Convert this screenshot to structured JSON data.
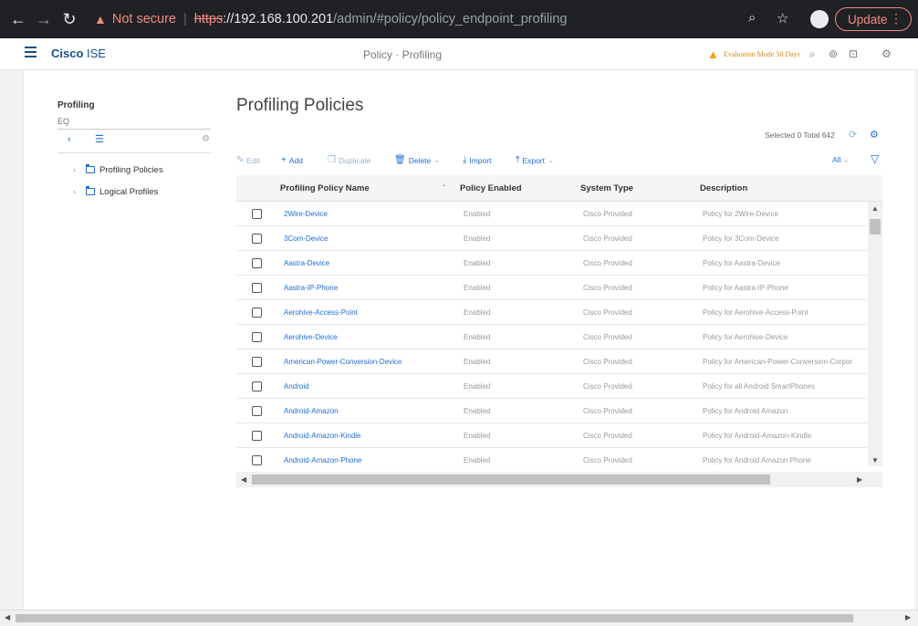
{
  "browser": {
    "not_secure": "Not secure",
    "url_scheme": "https",
    "url_host": "://192.168.100.201",
    "url_path": "/admin/#policy/policy_endpoint_profiling",
    "update_label": "Update"
  },
  "header": {
    "brand_cisco": "Cisco",
    "brand_product": " ISE",
    "title": "Policy · Profiling",
    "evaluation": "Evaluation Mode 50 Days"
  },
  "nav": {
    "title": "Profiling",
    "search_placeholder": "EQ",
    "items": [
      {
        "label": "Profiling Policies"
      },
      {
        "label": "Logical Profiles"
      }
    ]
  },
  "main": {
    "title": "Profiling Policies",
    "selected_total": "Selected 0  Total 642",
    "toolbar": {
      "edit": "Edit",
      "add": "Add",
      "duplicate": "Duplicate",
      "delete": "Delete",
      "import": "Import",
      "export": "Export",
      "filter": "All"
    }
  },
  "table": {
    "columns": [
      "Profiling Policy Name",
      "Policy Enabled",
      "System Type",
      "Description"
    ],
    "rows": [
      {
        "name": "2Wire-Device",
        "enabled": "Enabled",
        "type": "Cisco Provided",
        "desc": "Policy for 2Wire-Device"
      },
      {
        "name": "3Com-Device",
        "enabled": "Enabled",
        "type": "Cisco Provided",
        "desc": "Policy for 3Com-Device"
      },
      {
        "name": "Aastra-Device",
        "enabled": "Enabled",
        "type": "Cisco Provided",
        "desc": "Policy for Aastra-Device"
      },
      {
        "name": "Aastra-IP-Phone",
        "enabled": "Enabled",
        "type": "Cisco Provided",
        "desc": "Policy for Aastra-IP-Phone"
      },
      {
        "name": "Aerohive-Access-Point",
        "enabled": "Enabled",
        "type": "Cisco Provided",
        "desc": "Policy for Aerohive-Access-Point"
      },
      {
        "name": "Aerohive-Device",
        "enabled": "Enabled",
        "type": "Cisco Provided",
        "desc": "Policy for Aerohive-Device"
      },
      {
        "name": "American-Power-Conversion-Device",
        "enabled": "Enabled",
        "type": "Cisco Provided",
        "desc": "Policy for American-Power-Conversion-Corpor"
      },
      {
        "name": "Android",
        "enabled": "Enabled",
        "type": "Cisco Provided",
        "desc": "Policy for all Android SmartPhones"
      },
      {
        "name": "Android-Amazon",
        "enabled": "Enabled",
        "type": "Cisco Provided",
        "desc": "Policy for Android Amazon"
      },
      {
        "name": "Android-Amazon-Kindle",
        "enabled": "Enabled",
        "type": "Cisco Provided",
        "desc": "Policy for Android-Amazon-Kindle"
      },
      {
        "name": "Android-Amazon-Phone",
        "enabled": "Enabled",
        "type": "Cisco Provided",
        "desc": "Policy for Android Amazon Phone"
      }
    ]
  }
}
